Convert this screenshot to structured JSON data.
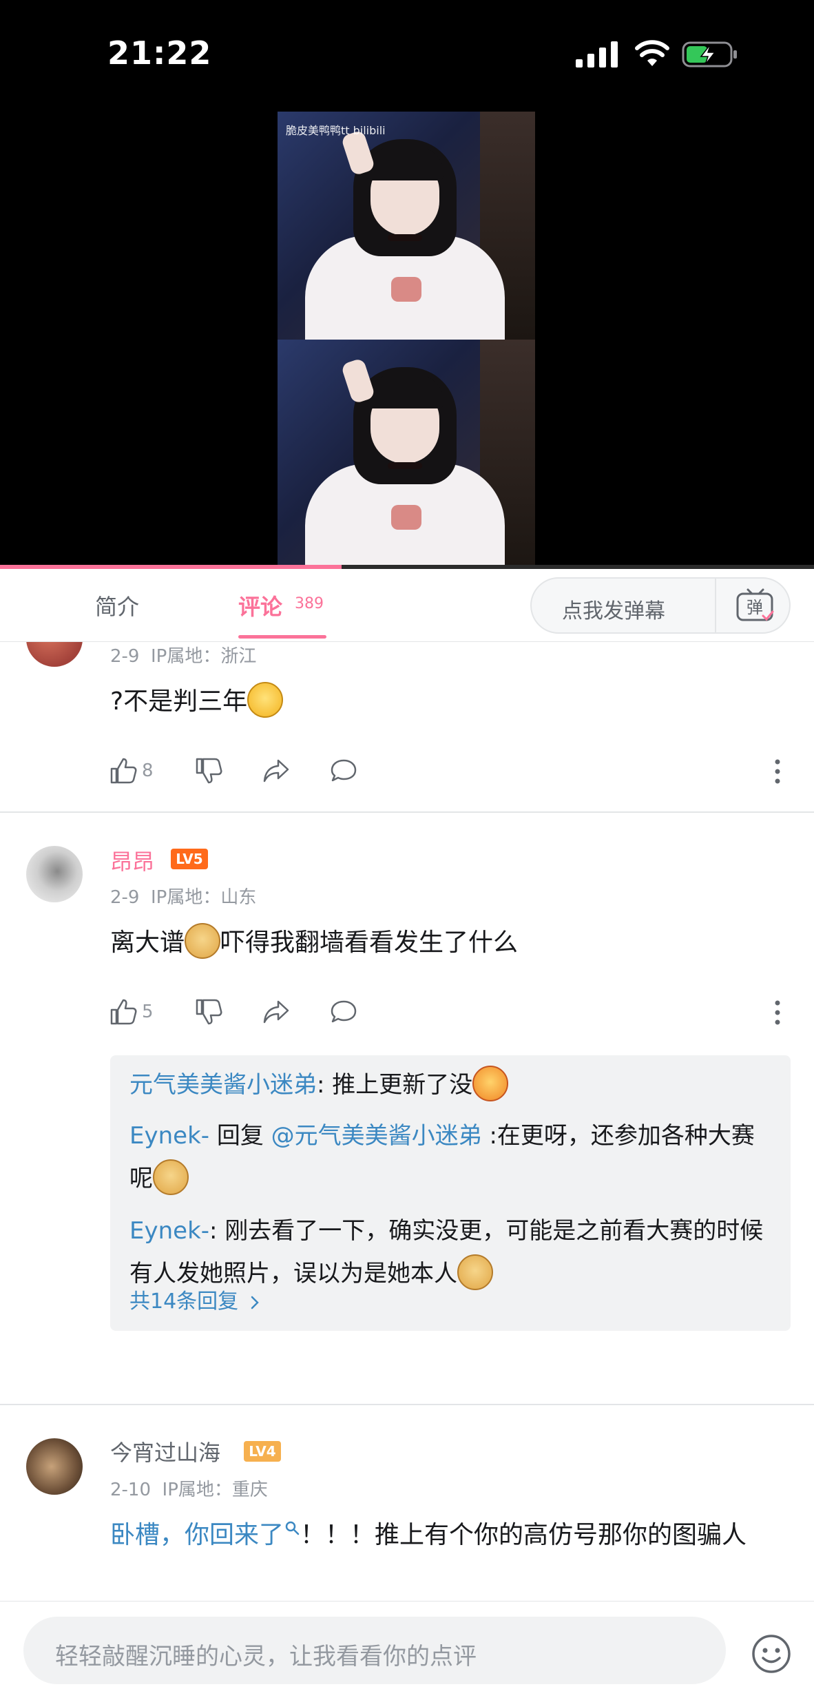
{
  "status_bar": {
    "time": "21:22",
    "battery_state": "charging"
  },
  "video": {
    "watermark": "脆皮美鸭鸭tt bilibili",
    "progress_fraction": 0.42
  },
  "tabs": {
    "intro_label": "简介",
    "comments_label": "评论",
    "comments_count": "389",
    "danmaku_placeholder": "点我发弹幕",
    "danmaku_icon": "弹"
  },
  "comments": [
    {
      "meta_date": "2-9",
      "meta_ip": "IP属地：浙江",
      "text": "?不是判三年",
      "emoji": "dizzy-face",
      "likes": "8"
    },
    {
      "username": "昂昂",
      "level": "LV5",
      "meta_date": "2-9",
      "meta_ip": "IP属地：山东",
      "text_before": "离大谱",
      "emoji": "doge",
      "text_after": "吓得我翻墙看看发生了什么",
      "likes": "5",
      "replies": [
        {
          "user": "元气美美酱小迷弟",
          "sep": ": ",
          "text": "推上更新了没",
          "emoji": "drool"
        },
        {
          "user": "Eynek-",
          "action": " 回复 ",
          "mention": "@元气美美酱小迷弟",
          "text": " :在更呀，还参加各种大赛呢",
          "emoji": "doge"
        },
        {
          "user": "Eynek-",
          "sep": ": ",
          "text": "刚去看了一下，确实没更，可能是之前看大赛的时候有人发她照片，误以为是她本人",
          "emoji": "doge"
        }
      ],
      "more_replies": "共14条回复"
    },
    {
      "username": "今宵过山海",
      "level": "LV4",
      "meta_date": "2-10",
      "meta_ip": "IP属地：重庆",
      "link_text": "卧槽，你回来了",
      "text": "！！！推上有个你的高仿号那你的图骗人"
    }
  ],
  "input": {
    "placeholder": "轻轻敲醒沉睡的心灵，让我看看你的点评"
  },
  "colors": {
    "accent": "#fb7299",
    "link": "#3b88c2",
    "lv5": "#ff6a1a",
    "lv4": "#f6b04f"
  },
  "icons": [
    "signal-icon",
    "wifi-icon",
    "battery-charging-icon",
    "danmaku-icon",
    "like-icon",
    "dislike-icon",
    "share-icon",
    "reply-icon",
    "more-icon",
    "emoji-icon",
    "search-icon",
    "chevron-right-icon"
  ]
}
